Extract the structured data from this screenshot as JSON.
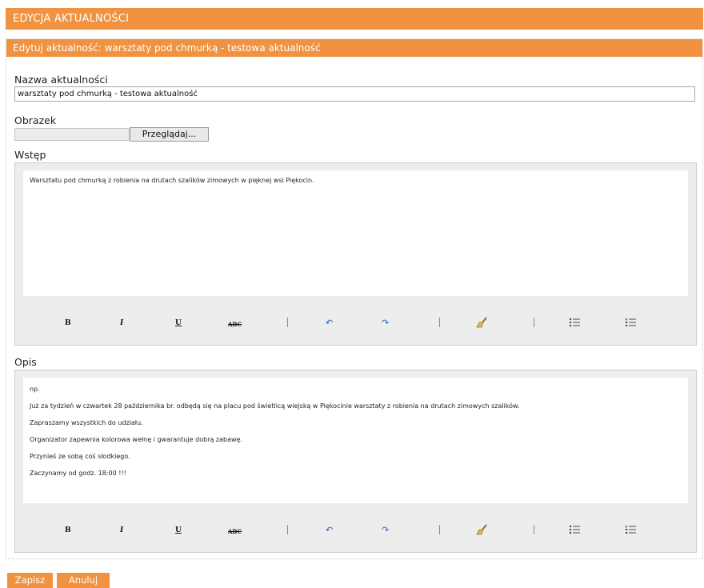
{
  "page": {
    "title": "EDYCJA AKTUALNOŚCI"
  },
  "form": {
    "header": "Edytuj aktualność: warsztaty pod chmurką - testowa aktualność",
    "name": {
      "label": "Nazwa aktualności",
      "value": "warsztaty pod chmurką - testowa aktualność"
    },
    "image": {
      "label": "Obrazek",
      "browse_label": "Przeglądaj..."
    },
    "intro": {
      "label": "Wstęp",
      "content": [
        "Warsztatu pod chmurką z robienia na drutach szalików zimowych w pięknej wsi Piękocin."
      ]
    },
    "description": {
      "label": "Opis",
      "content": [
        "np.",
        "Już za tydzień w czwartek 28 października br. odbędą się na placu pod świetlicą wiejską w Piękocinie warsztaty z robienia na drutach zimowych szalików.",
        "Zapraszamy wszystkich do udziału.",
        "Organizator zapewnia kolorowa wełnę i gwarantuje dobrą zabawę.",
        "Przynieś ze sobą coś słodkiego.",
        "Zaczynamy od godz. 18:00 !!!"
      ]
    }
  },
  "toolbar": {
    "bold": "B",
    "italic": "I",
    "underline": "U",
    "strikethrough": "ABC",
    "icons": [
      "bold-icon",
      "italic-icon",
      "underline-icon",
      "strikethrough-icon",
      "undo-icon",
      "redo-icon",
      "clear-format-icon",
      "bullet-list-icon",
      "numbered-list-icon"
    ]
  },
  "actions": {
    "save_label": "Zapisz",
    "cancel_label": "Anuluj"
  },
  "colors": {
    "accent": "#f0923f",
    "editor_bg": "#ededed",
    "icon_blue": "#2f64b8"
  }
}
